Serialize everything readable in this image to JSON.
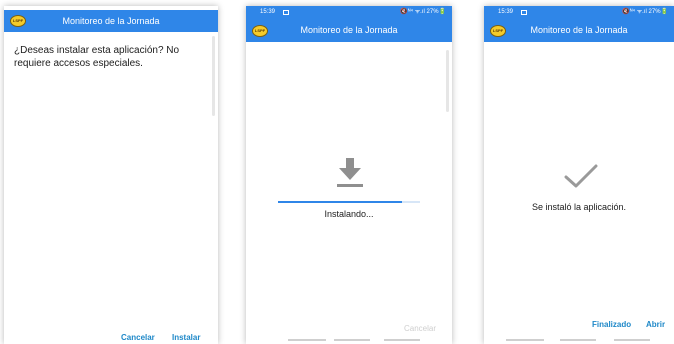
{
  "app": {
    "title": "Monitoreo de la Jornada",
    "logo_text": "LSPF"
  },
  "status": {
    "time": "15:39",
    "icons_text": "🔇ᴺ⁴ ᯤ.ıl 27%🔋"
  },
  "screen1": {
    "question": "¿Deseas instalar esta aplicación? No requiere accesos especiales.",
    "cancel_label": "Cancelar",
    "install_label": "Instalar"
  },
  "screen2": {
    "installing_label": "Instalando...",
    "cancel_label": "Cancelar",
    "progress": 0.87
  },
  "screen3": {
    "installed_label": "Se instaló la aplicación.",
    "done_label": "Finalizado",
    "open_label": "Abrir"
  },
  "icons": {
    "download": "download-icon",
    "check": "checkmark-icon"
  },
  "colors": {
    "app_bar": "#2f86e8",
    "accent_button": "#1e88c8",
    "disabled_button": "#cfcfcf",
    "logo": "#f5cb2a"
  }
}
